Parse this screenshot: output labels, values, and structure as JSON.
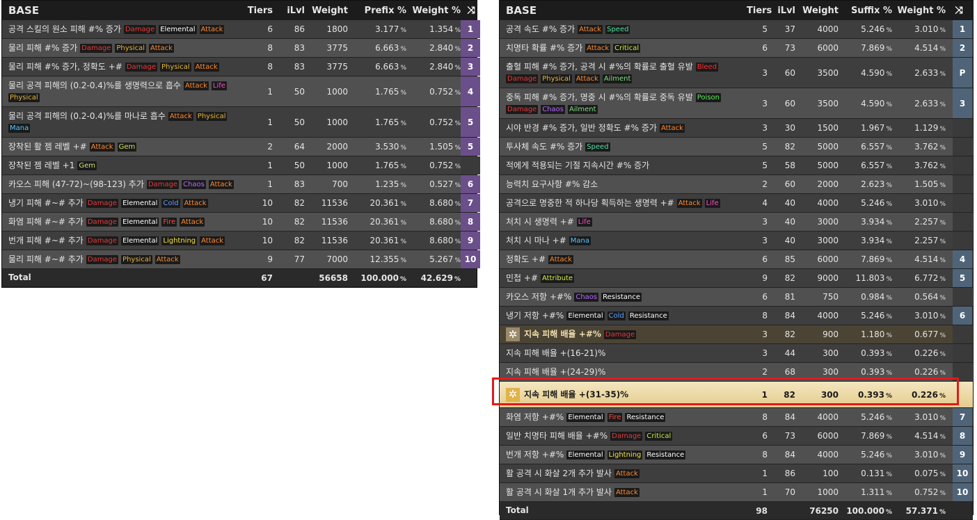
{
  "left": {
    "headers": {
      "base": "BASE",
      "tiers": "Tiers",
      "ilvl": "iLvl",
      "weight": "Weight",
      "pct": "Prefix %",
      "wpct": "Weight %",
      "shuffle": "⤨"
    },
    "rows": [
      {
        "name": "공격 스킬의 원소 피해 #% 증가",
        "tags": [
          [
            "Damage",
            "damage"
          ],
          [
            "Elemental",
            "elemental"
          ],
          [
            "Attack",
            "attack"
          ]
        ],
        "tiers": "6",
        "ilvl": "86",
        "weight": "1800",
        "pct": "3.177",
        "wpct": "1.354",
        "idx": "1"
      },
      {
        "name": "물리 피해 #% 증가",
        "tags": [
          [
            "Damage",
            "damage"
          ],
          [
            "Physical",
            "physical"
          ],
          [
            "Attack",
            "attack"
          ]
        ],
        "tiers": "8",
        "ilvl": "83",
        "weight": "3775",
        "pct": "6.663",
        "wpct": "2.840",
        "idx": "2"
      },
      {
        "name": "물리 피해 #% 증가, 정확도 +#",
        "tags": [
          [
            "Damage",
            "damage"
          ],
          [
            "Physical",
            "physical"
          ],
          [
            "Attack",
            "attack"
          ]
        ],
        "tiers": "8",
        "ilvl": "83",
        "weight": "3775",
        "pct": "6.663",
        "wpct": "2.840",
        "idx": "3"
      },
      {
        "name": "물리 공격 피해의 (0.2-0.4)%를 생명력으로 흡수",
        "tags": [
          [
            "Attack",
            "attack"
          ],
          [
            "Life",
            "life"
          ]
        ],
        "tags2": [
          [
            "Physical",
            "physical"
          ]
        ],
        "tiers": "1",
        "ilvl": "50",
        "weight": "1000",
        "pct": "1.765",
        "wpct": "0.752",
        "idx": "4"
      },
      {
        "name": "물리 공격 피해의 (0.2-0.4)%를 마나로 흡수",
        "tags": [
          [
            "Attack",
            "attack"
          ],
          [
            "Physical",
            "physical"
          ]
        ],
        "tags2": [
          [
            "Mana",
            "mana"
          ]
        ],
        "tiers": "1",
        "ilvl": "50",
        "weight": "1000",
        "pct": "1.765",
        "wpct": "0.752",
        "idx": "5"
      },
      {
        "name": "장착된 활 젬 레벨 +#",
        "tags": [
          [
            "Attack",
            "attack"
          ],
          [
            "Gem",
            "gem"
          ]
        ],
        "tiers": "2",
        "ilvl": "64",
        "weight": "2000",
        "pct": "3.530",
        "wpct": "1.505",
        "idx": "5"
      },
      {
        "name": "장착된 젬 레벨 +1",
        "tags": [
          [
            "Gem",
            "gem"
          ]
        ],
        "tiers": "1",
        "ilvl": "50",
        "weight": "1000",
        "pct": "1.765",
        "wpct": "0.752",
        "idx": ""
      },
      {
        "name": "카오스 피해 (47-72)~(98-123) 추가",
        "tags": [
          [
            "Damage",
            "damage"
          ],
          [
            "Chaos",
            "chaos"
          ],
          [
            "Attack",
            "attack"
          ]
        ],
        "tiers": "1",
        "ilvl": "83",
        "weight": "700",
        "pct": "1.235",
        "wpct": "0.527",
        "idx": "6"
      },
      {
        "name": "냉기 피해 #~# 추가",
        "tags": [
          [
            "Damage",
            "damage"
          ],
          [
            "Elemental",
            "elemental"
          ],
          [
            "Cold",
            "cold"
          ],
          [
            "Attack",
            "attack"
          ]
        ],
        "tiers": "10",
        "ilvl": "82",
        "weight": "11536",
        "pct": "20.361",
        "wpct": "8.680",
        "idx": "7"
      },
      {
        "name": "화염 피해 #~# 추가",
        "tags": [
          [
            "Damage",
            "damage"
          ],
          [
            "Elemental",
            "elemental"
          ],
          [
            "Fire",
            "fire"
          ],
          [
            "Attack",
            "attack"
          ]
        ],
        "tiers": "10",
        "ilvl": "82",
        "weight": "11536",
        "pct": "20.361",
        "wpct": "8.680",
        "idx": "8"
      },
      {
        "name": "번개 피해 #~# 추가",
        "tags": [
          [
            "Damage",
            "damage"
          ],
          [
            "Elemental",
            "elemental"
          ],
          [
            "Lightning",
            "lightning"
          ],
          [
            "Attack",
            "attack"
          ]
        ],
        "tiers": "10",
        "ilvl": "82",
        "weight": "11536",
        "pct": "20.361",
        "wpct": "8.680",
        "idx": "9"
      },
      {
        "name": "물리 피해 #~# 추가",
        "tags": [
          [
            "Damage",
            "damage"
          ],
          [
            "Physical",
            "physical"
          ],
          [
            "Attack",
            "attack"
          ]
        ],
        "tiers": "9",
        "ilvl": "77",
        "weight": "7000",
        "pct": "12.355",
        "wpct": "5.267",
        "idx": "10"
      }
    ],
    "total": {
      "label": "Total",
      "tiers": "67",
      "weight": "56658",
      "pct": "100.000",
      "wpct": "42.629"
    }
  },
  "right": {
    "headers": {
      "base": "BASE",
      "tiers": "Tiers",
      "ilvl": "iLvl",
      "weight": "Weight",
      "pct": "Suffix %",
      "wpct": "Weight %",
      "shuffle": "⤨"
    },
    "rows": [
      {
        "name": "공격 속도 #% 증가",
        "tags": [
          [
            "Attack",
            "attack"
          ],
          [
            "Speed",
            "speed"
          ]
        ],
        "tiers": "5",
        "ilvl": "37",
        "weight": "4000",
        "pct": "5.246",
        "wpct": "3.010",
        "idx": "1"
      },
      {
        "name": "치명타 확률 #% 증가",
        "tags": [
          [
            "Attack",
            "attack"
          ],
          [
            "Critical",
            "critical"
          ]
        ],
        "tiers": "6",
        "ilvl": "73",
        "weight": "6000",
        "pct": "7.869",
        "wpct": "4.514",
        "idx": "2"
      },
      {
        "name": "출혈 피해 #% 증가, 공격 시 #%의 확률로 출혈 유발",
        "tags": [
          [
            "Bleed",
            "bleed"
          ]
        ],
        "tags2": [
          [
            "Damage",
            "damage"
          ],
          [
            "Physical",
            "physical"
          ],
          [
            "Attack",
            "attack"
          ],
          [
            "Ailment",
            "ailment"
          ]
        ],
        "tiers": "3",
        "ilvl": "60",
        "weight": "3500",
        "pct": "4.590",
        "wpct": "2.633",
        "idx": "P"
      },
      {
        "name": "중독 피해 #% 증가, 명중 시 #%의 확률로 중독 유발",
        "tags": [
          [
            "Poison",
            "poison"
          ]
        ],
        "tags2": [
          [
            "Damage",
            "damage"
          ],
          [
            "Chaos",
            "chaos"
          ],
          [
            "Ailment",
            "ailment"
          ]
        ],
        "tiers": "3",
        "ilvl": "60",
        "weight": "3500",
        "pct": "4.590",
        "wpct": "2.633",
        "idx": "3"
      },
      {
        "name": "시야 반경 #% 증가, 일반 정확도 #% 증가",
        "tags": [
          [
            "Attack",
            "attack"
          ]
        ],
        "tiers": "3",
        "ilvl": "30",
        "weight": "1500",
        "pct": "1.967",
        "wpct": "1.129",
        "idx": ""
      },
      {
        "name": "투사체 속도 #% 증가",
        "tags": [
          [
            "Speed",
            "speed"
          ]
        ],
        "tiers": "5",
        "ilvl": "82",
        "weight": "5000",
        "pct": "6.557",
        "wpct": "3.762",
        "idx": ""
      },
      {
        "name": "적에게 적용되는 기절 지속시간 #% 증가",
        "tags": [],
        "tiers": "5",
        "ilvl": "58",
        "weight": "5000",
        "pct": "6.557",
        "wpct": "3.762",
        "idx": ""
      },
      {
        "name": "능력치 요구사항 #% 감소",
        "tags": [],
        "tiers": "2",
        "ilvl": "60",
        "weight": "2000",
        "pct": "2.623",
        "wpct": "1.505",
        "idx": ""
      },
      {
        "name": "공격으로 명중한 적 하나당 획득하는 생명력 +#",
        "tags": [
          [
            "Attack",
            "attack"
          ],
          [
            "Life",
            "life"
          ]
        ],
        "tiers": "4",
        "ilvl": "40",
        "weight": "4000",
        "pct": "5.246",
        "wpct": "3.010",
        "idx": ""
      },
      {
        "name": "처치 시 생명력 +#",
        "tags": [
          [
            "Life",
            "life"
          ]
        ],
        "tiers": "3",
        "ilvl": "40",
        "weight": "3000",
        "pct": "3.934",
        "wpct": "2.257",
        "idx": ""
      },
      {
        "name": "처치 시 마나 +#",
        "tags": [
          [
            "Mana",
            "mana"
          ]
        ],
        "tiers": "3",
        "ilvl": "40",
        "weight": "3000",
        "pct": "3.934",
        "wpct": "2.257",
        "idx": ""
      },
      {
        "name": "정확도 +#",
        "tags": [
          [
            "Attack",
            "attack"
          ]
        ],
        "tiers": "6",
        "ilvl": "85",
        "weight": "6000",
        "pct": "7.869",
        "wpct": "4.514",
        "idx": "4"
      },
      {
        "name": "민첩 +#",
        "tags": [
          [
            "Attribute",
            "attribute"
          ]
        ],
        "tiers": "9",
        "ilvl": "82",
        "weight": "9000",
        "pct": "11.803",
        "wpct": "6.772",
        "idx": "5"
      },
      {
        "name": "카오스 저항 +#%",
        "tags": [
          [
            "Chaos",
            "chaos"
          ],
          [
            "Resistance",
            "resistance"
          ]
        ],
        "tiers": "6",
        "ilvl": "81",
        "weight": "750",
        "pct": "0.984",
        "wpct": "0.564",
        "idx": ""
      },
      {
        "name": "냉기 저항 +#%",
        "tags": [
          [
            "Elemental",
            "elemental"
          ],
          [
            "Cold",
            "cold"
          ],
          [
            "Resistance",
            "resistance"
          ]
        ],
        "tiers": "8",
        "ilvl": "84",
        "weight": "4000",
        "pct": "5.246",
        "wpct": "3.010",
        "idx": "6"
      },
      {
        "name": "지속 피해 배율 +#%",
        "tags": [
          [
            "Damage",
            "damage"
          ]
        ],
        "tiers": "3",
        "ilvl": "82",
        "weight": "900",
        "pct": "1.180",
        "wpct": "0.677",
        "idx": "",
        "group": true
      },
      {
        "name": "지속 피해 배율 +(16-21)%",
        "tags": [],
        "tiers": "3",
        "ilvl": "44",
        "weight": "300",
        "pct": "0.393",
        "wpct": "0.226",
        "idx": "",
        "sub": true
      },
      {
        "name": "지속 피해 배율 +(24-29)%",
        "tags": [],
        "tiers": "2",
        "ilvl": "68",
        "weight": "300",
        "pct": "0.393",
        "wpct": "0.226",
        "idx": "",
        "sub": true
      },
      {
        "name": "지속 피해 배율 +(31-35)%",
        "tags": [],
        "tiers": "1",
        "ilvl": "82",
        "weight": "300",
        "pct": "0.393",
        "wpct": "0.226",
        "idx": "",
        "selected": true
      },
      {
        "name": "화염 저항 +#%",
        "tags": [
          [
            "Elemental",
            "elemental"
          ],
          [
            "Fire",
            "fire"
          ],
          [
            "Resistance",
            "resistance"
          ]
        ],
        "tiers": "8",
        "ilvl": "84",
        "weight": "4000",
        "pct": "5.246",
        "wpct": "3.010",
        "idx": "7"
      },
      {
        "name": "일반 치명타 피해 배율 +#%",
        "tags": [
          [
            "Damage",
            "damage"
          ],
          [
            "Critical",
            "critical"
          ]
        ],
        "tiers": "6",
        "ilvl": "73",
        "weight": "6000",
        "pct": "7.869",
        "wpct": "4.514",
        "idx": "8"
      },
      {
        "name": "번개 저항 +#%",
        "tags": [
          [
            "Elemental",
            "elemental"
          ],
          [
            "Lightning",
            "lightning"
          ],
          [
            "Resistance",
            "resistance"
          ]
        ],
        "tiers": "8",
        "ilvl": "84",
        "weight": "4000",
        "pct": "5.246",
        "wpct": "3.010",
        "idx": "9"
      },
      {
        "name": "활 공격 시 화살 2개 추가 발사",
        "tags": [
          [
            "Attack",
            "attack"
          ]
        ],
        "tiers": "1",
        "ilvl": "86",
        "weight": "100",
        "pct": "0.131",
        "wpct": "0.075",
        "idx": "10"
      },
      {
        "name": "활 공격 시 화살 1개 추가 발사",
        "tags": [
          [
            "Attack",
            "attack"
          ]
        ],
        "tiers": "1",
        "ilvl": "70",
        "weight": "1000",
        "pct": "1.311",
        "wpct": "0.752",
        "idx": "10"
      }
    ],
    "total": {
      "label": "Total",
      "tiers": "98",
      "weight": "76250",
      "pct": "100.000",
      "wpct": "57.371"
    }
  },
  "pct_sign": "%",
  "group_star": "✲",
  "colors": {
    "idx_prefix": "#6b4f8a",
    "idx_suffix": "#4f6478",
    "idx_suffix_mid": "#5a6e7f",
    "highlight_border": "#e01b1b",
    "selected_bg": "#ead39a"
  }
}
